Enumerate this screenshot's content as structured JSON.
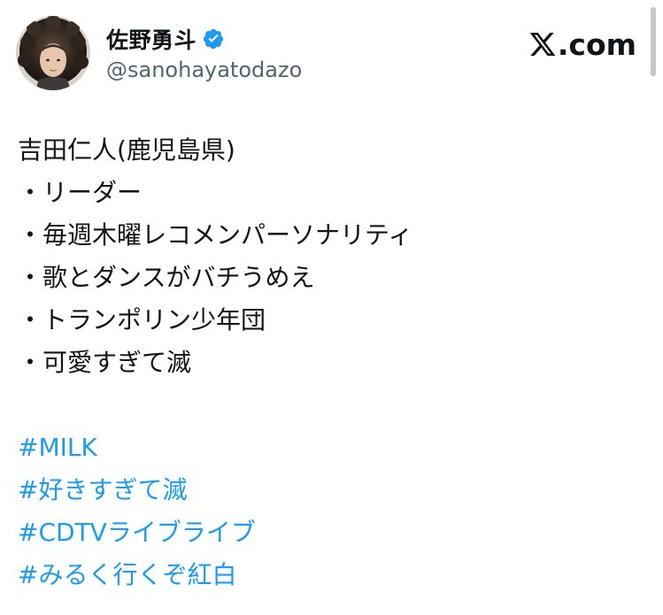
{
  "author": {
    "display_name": "佐野勇斗",
    "handle": "@sanohayatodazo",
    "verified": true
  },
  "brand": {
    "text": ".com"
  },
  "tweet": {
    "lines": [
      "吉田仁人(鹿児島県)",
      "・リーダー",
      "・毎週木曜レコメンパーソナリティ",
      "・歌とダンスがバチうめえ",
      "・トランポリン少年団",
      "・可愛すぎて滅"
    ],
    "hashtags": [
      "#MILK",
      "#好きすぎて滅",
      "#CDTVライブライブ",
      "#みるく行くぞ紅白"
    ]
  },
  "colors": {
    "link": "#1d9bf0",
    "verified": "#1d9bf0",
    "text": "#0f1419",
    "secondary": "#536471"
  },
  "icons": {
    "verified": "verified-badge-icon",
    "brand": "x-logo-icon"
  }
}
